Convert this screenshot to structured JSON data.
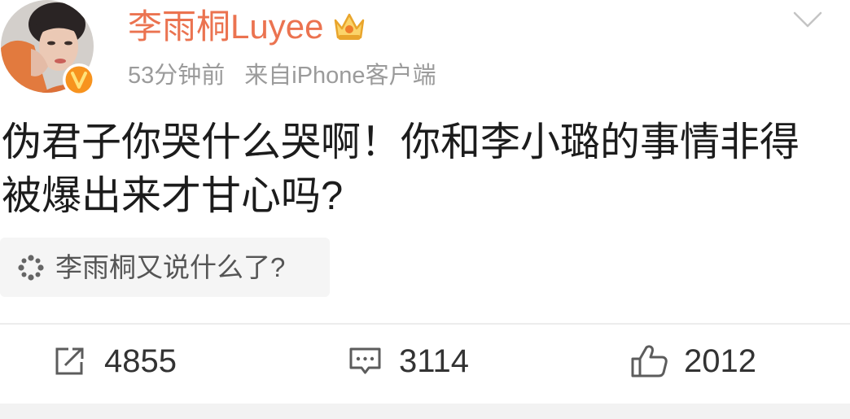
{
  "user": {
    "name": "李雨桐Luyee",
    "avatar_icon": "avatar",
    "verified_badge_icon": "verified-v-icon",
    "member_badge_icon": "crown-icon"
  },
  "post": {
    "time": "53分钟前",
    "source": "来自iPhone客户端",
    "content": "伪君子你哭什么哭啊！你和李小璐的事情非得被爆出来才甘心吗?"
  },
  "menu": {
    "icon": "chevron-down-icon"
  },
  "topic": {
    "icon": "sparkle-icon",
    "text": "李雨桐又说什么了?"
  },
  "actions": {
    "repost": {
      "icon": "repost-icon",
      "count": "4855"
    },
    "comment": {
      "icon": "comment-icon",
      "count": "3114"
    },
    "like": {
      "icon": "thumbs-up-icon",
      "count": "2012"
    }
  },
  "colors": {
    "username": "#eb7350",
    "verified_badge": "#f7931e",
    "crown": "#fbd46a",
    "meta_text": "#9b9b9b"
  }
}
